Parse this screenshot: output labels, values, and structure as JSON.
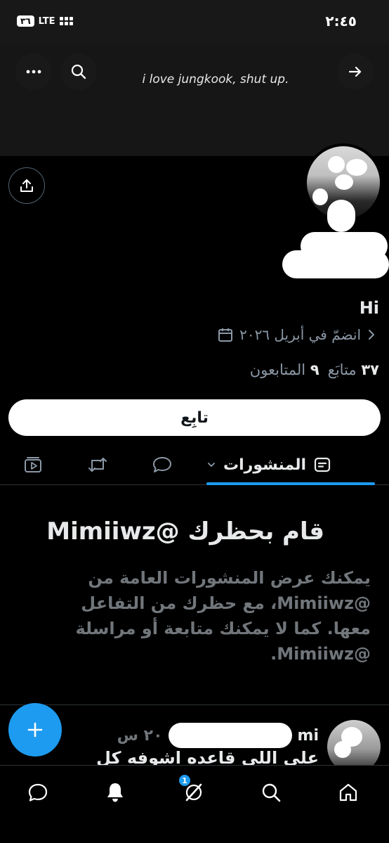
{
  "status_bar": {
    "time": "٢:٤٥",
    "battery": "٣٦",
    "network": "LTE"
  },
  "header": {
    "banner_text": "i love jungkook, shut up."
  },
  "profile": {
    "handle_label": "Hi",
    "joined": "انضمّ في أبريل ٢٠٢٦",
    "following_count": "٣٧",
    "following_label": "متابَع",
    "followers_count": "٩",
    "followers_label": "المتابعون",
    "follow_button": "تابِع"
  },
  "tabs": {
    "active_label": "المنشورات"
  },
  "blocked": {
    "title": "قام بحظرك @Mimiiwz",
    "body": "يمكنك عرض المنشورات العامة من @Mimiiwz، مع حظرك من التفاعل معها. كما لا يمكنك متابعة أو مراسلة @Mimiiwz."
  },
  "post_preview": {
    "name_fragment": "mi",
    "time": "٢٠ س",
    "text": "على اللي قاعده اشوفه كل"
  },
  "bottom_nav": {
    "notification_badge": "1"
  },
  "colors": {
    "accent": "#1d9bf0",
    "background": "#000000",
    "muted_text": "#71767b"
  }
}
